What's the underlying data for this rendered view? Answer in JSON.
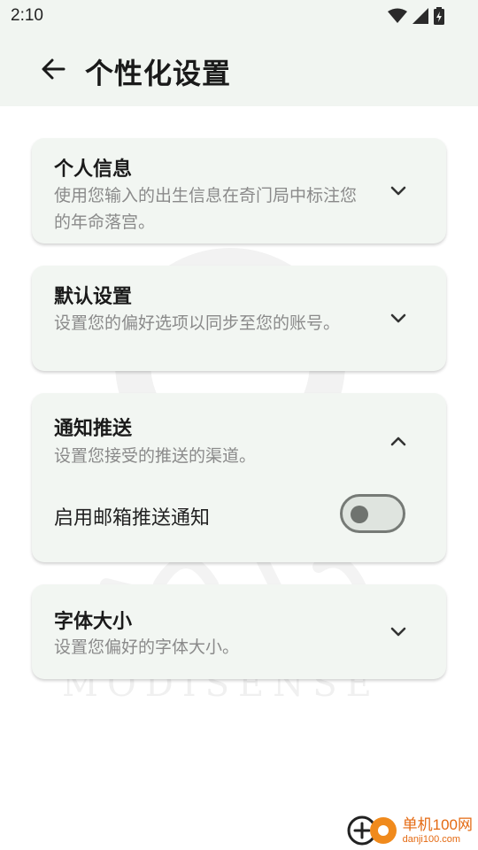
{
  "status_bar": {
    "time": "2:10"
  },
  "app_bar": {
    "title": "个性化设置"
  },
  "watermark": {
    "text": "MODISENSE"
  },
  "cards": [
    {
      "title": "个人信息",
      "description": "使用您输入的出生信息在奇门局中标注您的年命落宫。",
      "expanded": false
    },
    {
      "title": "默认设置",
      "description": "设置您的偏好选项以同步至您的账号。",
      "expanded": false
    },
    {
      "title": "通知推送",
      "description": "设置您接受的推送的渠道。",
      "expanded": true,
      "toggle": {
        "label": "启用邮箱推送通知",
        "enabled": false
      }
    },
    {
      "title": "字体大小",
      "description": "设置您偏好的字体大小。",
      "expanded": false
    }
  ],
  "brand": {
    "name": "单机100网",
    "url": "danji100.com"
  },
  "colors": {
    "appbar": "#f1f5f1",
    "card": "#f2f6f2",
    "accent": "#e46a12"
  }
}
